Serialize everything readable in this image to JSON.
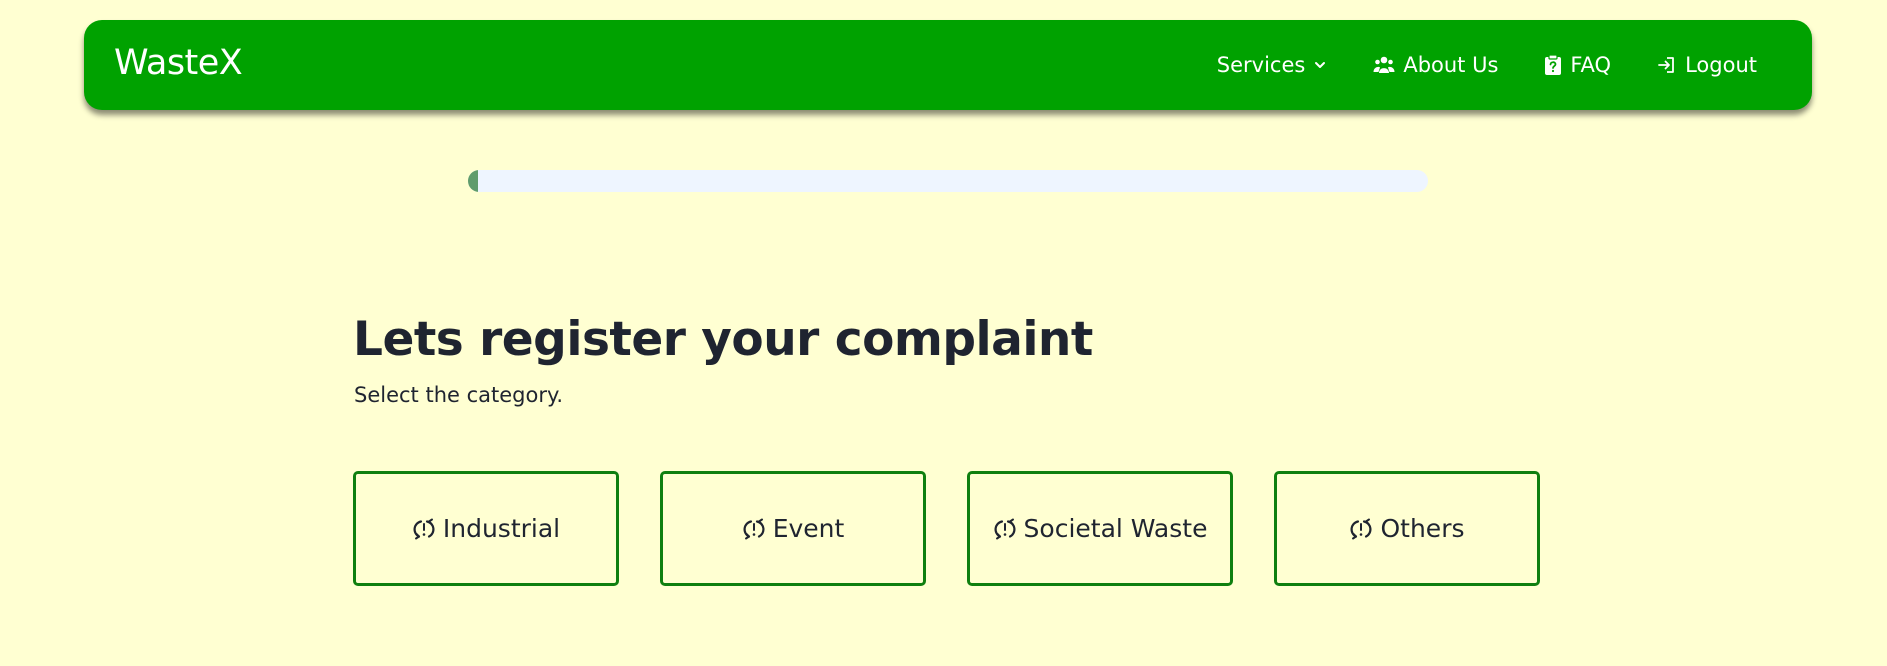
{
  "nav": {
    "brand": "WasteX",
    "links": [
      {
        "label": "Services",
        "icon": "chevron-down-icon"
      },
      {
        "label": "About Us",
        "icon": "people-icon"
      },
      {
        "label": "FAQ",
        "icon": "clipboard-question-icon"
      },
      {
        "label": "Logout",
        "icon": "login-icon"
      }
    ]
  },
  "progress": {
    "value_percent": 1
  },
  "main": {
    "heading": "Lets register your complaint",
    "subheading": "Select the category."
  },
  "categories": [
    {
      "label": "Industrial",
      "icon": "recycle-alert-icon"
    },
    {
      "label": "Event",
      "icon": "recycle-alert-icon"
    },
    {
      "label": "Societal Waste",
      "icon": "recycle-alert-icon"
    },
    {
      "label": "Others",
      "icon": "recycle-alert-icon"
    }
  ],
  "colors": {
    "background": "#ffffd2",
    "navbar": "#00a200",
    "progress_track": "#eef5ff",
    "progress_fill": "#609c6c",
    "category_border": "#0f7f0f"
  }
}
